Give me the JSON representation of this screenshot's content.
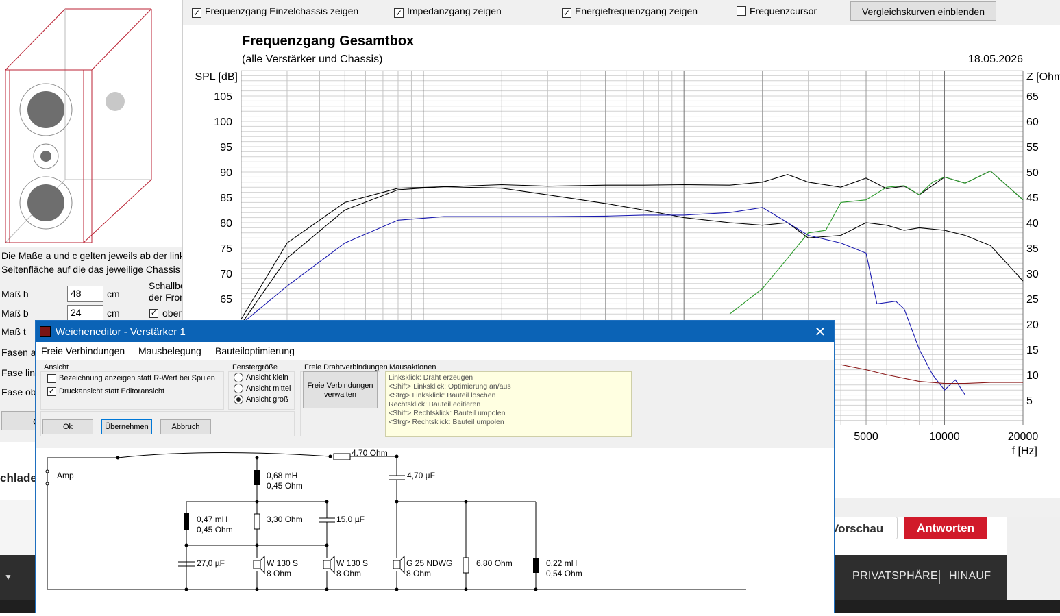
{
  "forum": {
    "preview_button": "Vorschau",
    "reply_button": "Antworten",
    "footer_links": [
      "PRIVATSPHÄRE",
      "HINAUF"
    ],
    "partial_text": "chlade",
    "dropdown_arrow": "▼"
  },
  "left_panel": {
    "info_line1": "Die Maße a und c gelten jeweils ab der linken",
    "info_line2": "Seitenfläche auf die das jeweilige Chassis mo",
    "h_label": "Maß h",
    "h_value": "48",
    "h_unit": "cm",
    "b_label": "Maß b",
    "b_value": "24",
    "b_unit": "cm",
    "t_label": "Maß t",
    "fasen_label": "Fasen an",
    "fase_links_label": "Fase link",
    "fase_oben_label": "Fase obe",
    "schall_label1": "Schallbe",
    "schall_label2": "der Fron",
    "oben_label": "ober",
    "btn_partial": "C"
  },
  "chart_window": {
    "checkboxes": [
      {
        "label": "Frequenzgang Einzelchassis zeigen",
        "checked": true
      },
      {
        "label": "Impedanzgang zeigen",
        "checked": true
      },
      {
        "label": "Energiefrequenzgang zeigen",
        "checked": true
      },
      {
        "label": "Frequenzcursor",
        "checked": false
      }
    ],
    "compare_button": "Vergleichskurven einblenden"
  },
  "chart_data": {
    "type": "line",
    "title": "Frequenzgang Gesamtbox",
    "subtitle": "(alle Verstärker und Chassis)",
    "date": "18.05.2026",
    "ylabel": "SPL [dB]",
    "y2label": "Z [Ohm]",
    "xlabel": "f [Hz]",
    "x_scale": "log",
    "xlim": [
      20,
      20000
    ],
    "ylim": [
      60,
      110
    ],
    "y2lim": [
      0,
      75
    ],
    "y_ticks": [
      105,
      100,
      95,
      90,
      85,
      80,
      75,
      70,
      65
    ],
    "y2_ticks": [
      65,
      60,
      55,
      50,
      45,
      40,
      35,
      30,
      25,
      20,
      15,
      10,
      5
    ],
    "x_tick_labels": [
      {
        "value": 5000,
        "label": "5000"
      },
      {
        "value": 10000,
        "label": "10000"
      },
      {
        "value": 20000,
        "label": "20000"
      }
    ],
    "series": [
      {
        "color": "#000000",
        "x": [
          20,
          30,
          50,
          80,
          120,
          200,
          300,
          500,
          700,
          1000,
          1500,
          2000,
          2500,
          3000,
          4000,
          5000,
          6000,
          7000,
          8000,
          10000,
          12000,
          15000,
          20000
        ],
        "y": [
          61,
          76,
          84,
          86.8,
          87.1,
          87.5,
          87.2,
          87.4,
          87.4,
          87.5,
          87.4,
          88,
          89.5,
          88,
          87,
          88.8,
          86.7,
          87.2,
          85.5,
          89,
          87.8,
          90.2,
          84.5
        ]
      },
      {
        "color": "#000000",
        "x": [
          20,
          30,
          50,
          80,
          120,
          200,
          300,
          500,
          700,
          1000,
          1500,
          2000,
          2500,
          3000,
          4000,
          5000,
          6000,
          7000,
          8000,
          10000,
          12000,
          15000,
          20000
        ],
        "y": [
          60,
          73,
          82.5,
          86.5,
          87.1,
          86.8,
          85.5,
          83.8,
          82.5,
          81,
          80,
          79.5,
          80,
          77,
          77.5,
          80,
          79.5,
          78.5,
          79,
          78.5,
          77.5,
          75.5,
          68.5
        ]
      },
      {
        "color": "#1a1ab0",
        "x": [
          20,
          30,
          50,
          80,
          120,
          200,
          300,
          500,
          700,
          1000,
          1500,
          2000,
          2500,
          3000,
          4000,
          5000,
          5500,
          6500,
          7000,
          8000,
          9000,
          10000,
          11000,
          12000
        ],
        "y": [
          60,
          67.5,
          76,
          80.5,
          81.2,
          81.2,
          81.2,
          81.3,
          81.5,
          81.5,
          82,
          83,
          80,
          77.5,
          76,
          74,
          64,
          64.5,
          63,
          55,
          50,
          47,
          49,
          46
        ]
      },
      {
        "color": "#2a9a2a",
        "x": [
          1500,
          2000,
          2500,
          3000,
          3500,
          4000,
          5000,
          6000,
          7000,
          8000,
          9000,
          10000,
          12000,
          15000,
          20000
        ],
        "y": [
          62,
          67,
          73,
          78,
          78.5,
          84,
          84.5,
          87,
          87.3,
          85.5,
          88,
          89,
          87.8,
          90.2,
          84.5
        ]
      },
      {
        "color": "#8b1a1a",
        "axis": "y2",
        "x": [
          4000,
          5000,
          6000,
          8000,
          10000,
          12000,
          15000,
          20000
        ],
        "y": [
          12,
          11,
          10,
          8.7,
          8.3,
          8.3,
          8.5,
          8.5
        ]
      }
    ]
  },
  "dialog": {
    "title": "Weicheneditor - Verstärker 1",
    "close_label": "✕",
    "menu": [
      "Freie Verbindungen",
      "Mausbelegung",
      "Bauteiloptimierung"
    ],
    "ansicht": {
      "title": "Ansicht",
      "options": [
        {
          "label": "Bezeichnung anzeigen statt R-Wert bei Spulen",
          "checked": false
        },
        {
          "label": "Druckansicht statt Editoransicht",
          "checked": true
        }
      ]
    },
    "fenster": {
      "title": "Fenstergröße",
      "options": [
        {
          "label": "Ansicht klein",
          "selected": false
        },
        {
          "label": "Ansicht mittel",
          "selected": false
        },
        {
          "label": "Ansicht groß",
          "selected": true
        }
      ]
    },
    "draht": {
      "title": "Freie Drahtverbindungen",
      "button_line1": "Freie Verbindungen",
      "button_line2": "verwalten"
    },
    "maus": {
      "title": "Mausaktionen",
      "lines": [
        "Linksklick: Draht erzeugen",
        "<Shift> Linksklick: Optimierung an/aus",
        "<Strg> Linksklick: Bauteil löschen",
        "Rechtsklick: Bauteil editieren",
        "<Shift> Rechtsklick: Bauteil umpolen",
        "<Strg> Rechtsklick: Bauteil umpolen"
      ]
    },
    "buttons": {
      "ok": "Ok",
      "apply": "Übernehmen",
      "cancel": "Abbruch"
    },
    "circuit": {
      "amp_label": "Amp",
      "r_series": "4,70 Ohm",
      "c_series": "4,70 µF",
      "l1_value": "0,68 mH",
      "l1_res": "0,45 Ohm",
      "l2_value": "0,47 mH",
      "l2_res": "0,45 Ohm",
      "r2": "3,30 Ohm",
      "c2": "15,0 µF",
      "c3": "27,0 µF",
      "d1_name": "W 130 S",
      "d1_imp": "8 Ohm",
      "d2_name": "W 130 S",
      "d2_imp": "8 Ohm",
      "d3_name": "G 25 NDWG",
      "d3_imp": "8 Ohm",
      "r3": "6,80 Ohm",
      "l3_value": "0,22 mH",
      "l3_res": "0,54 Ohm"
    }
  }
}
